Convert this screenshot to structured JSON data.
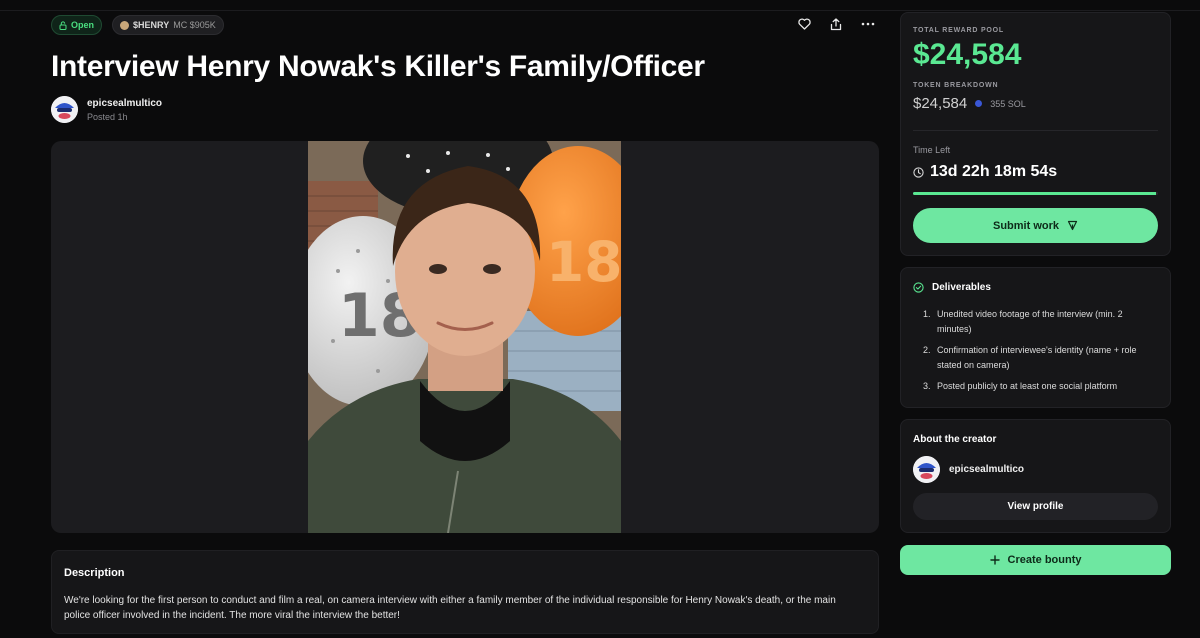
{
  "header": {
    "status_badge": "Open",
    "token_symbol": "$HENRY",
    "market_cap": "MC $905K",
    "title": "Interview Henry Nowak's Killer's Family/Officer"
  },
  "author": {
    "name": "epicsealmultico",
    "posted": "Posted 1h"
  },
  "actions": {
    "like_icon": "heart-icon",
    "share_icon": "share-icon",
    "more_icon": "more-icon"
  },
  "description": {
    "heading": "Description",
    "body": "We're looking for the first person to conduct and film a real, on camera interview with either a family member of the individual responsible for Henry Nowak's death, or the main police officer involved in the incident. The more viral the interview the better!"
  },
  "reward": {
    "pool_label": "TOTAL REWARD POOL",
    "pool_value": "$24,584",
    "breakdown_label": "TOKEN BREAKDOWN",
    "breakdown_usd": "$24,584",
    "breakdown_sol": "355 SOL",
    "time_label": "Time Left",
    "time_value": "13d 22h 18m 54s",
    "time_progress": 0.99,
    "submit_label": "Submit work"
  },
  "deliverables": {
    "heading": "Deliverables",
    "items": [
      {
        "num": "1.",
        "text": "Unedited video footage of the interview (min. 2 minutes)"
      },
      {
        "num": "2.",
        "text": "Confirmation of interviewee's identity (name + role stated on camera)"
      },
      {
        "num": "3.",
        "text": "Posted publicly to at least one social platform"
      }
    ]
  },
  "creator": {
    "heading": "About the creator",
    "name": "epicsealmultico",
    "view_profile": "View profile"
  },
  "create_bounty": "Create bounty",
  "colors": {
    "accent": "#5ae892",
    "button": "#6ee7a1",
    "background": "#0b0b0c",
    "card": "#161618"
  }
}
